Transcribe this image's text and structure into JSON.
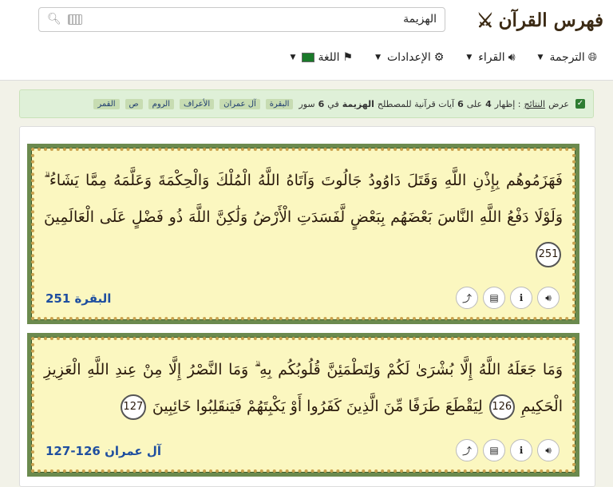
{
  "header": {
    "logo_text": "فهرس القرآن",
    "logo_icon": "crossed-swords-icon",
    "search": {
      "value": "الهزيمة",
      "placeholder": ""
    }
  },
  "menu": [
    {
      "label": "الترجمة",
      "icon": "globe-icon"
    },
    {
      "label": "القراء",
      "icon": "speaker-icon"
    },
    {
      "label": "الإعدادات",
      "icon": "gear-icon"
    },
    {
      "label": "اللغة",
      "icon": "flag-icon"
    }
  ],
  "notice": {
    "prefix": "عرض",
    "results_link": "النتائج",
    "sentence": ": إظهار",
    "shown": "4",
    "of_word": "على",
    "total": "6",
    "tail": "آيات قرآنية للمصطلح",
    "term": "الهزيمة",
    "in_word": "في",
    "surah_count": "6",
    "surah_word": "سور",
    "surahs": [
      "البقرة",
      "آل عمران",
      "الأعراف",
      "الروم",
      "ص",
      "القمر"
    ]
  },
  "verses": [
    {
      "text": "فَهَزَمُوهُم بِإِذْنِ اللَّهِ وَقَتَلَ دَاوُودُ جَالُوتَ وَآتَاهُ اللَّهُ الْمُلْكَ وَالْحِكْمَةَ وَعَلَّمَهُ مِمَّا يَشَاءُ ۗ وَلَوْلَا دَفْعُ اللَّهِ النَّاسَ بَعْضَهُم بِبَعْضٍ لَّفَسَدَتِ الْأَرْضُ وَلَٰكِنَّ اللَّهَ ذُو فَضْلٍ عَلَى الْعَالَمِينَ",
      "number": "251",
      "reference": "البقرة 251"
    },
    {
      "text_a": "وَمَا جَعَلَهُ اللَّهُ إِلَّا بُشْرَىٰ لَكُمْ وَلِتَطْمَئِنَّ قُلُوبُكُم بِهِ ۗ وَمَا النَّصْرُ إِلَّا مِنْ عِندِ اللَّهِ الْعَزِيزِ الْحَكِيمِ",
      "number_a": "126",
      "text_b": "لِيَقْطَعَ طَرَفًا مِّنَ الَّذِينَ كَفَرُوا أَوْ يَكْبِتَهُمْ فَيَنقَلِبُوا خَائِبِينَ",
      "number_b": "127",
      "reference": "آل عمران 126-127"
    }
  ],
  "tools": [
    "share-icon",
    "pdf-icon",
    "info-icon",
    "audio-icon"
  ]
}
